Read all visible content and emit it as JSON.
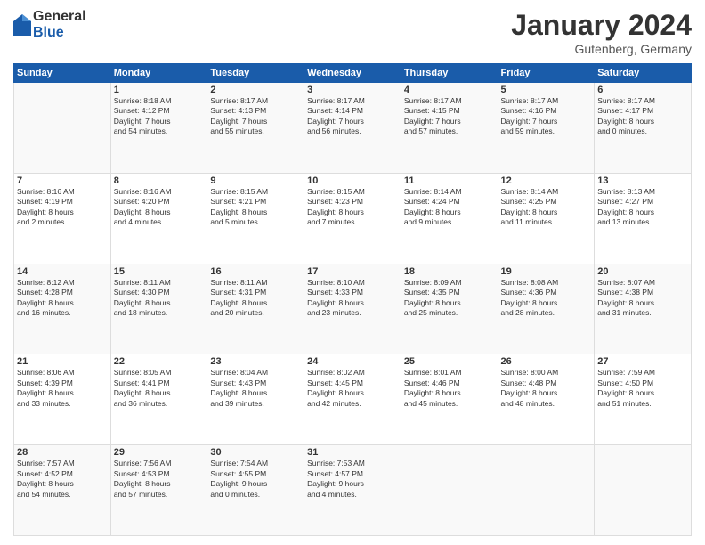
{
  "header": {
    "logo": {
      "general": "General",
      "blue": "Blue"
    },
    "title": "January 2024",
    "location": "Gutenberg, Germany"
  },
  "weekdays": [
    "Sunday",
    "Monday",
    "Tuesday",
    "Wednesday",
    "Thursday",
    "Friday",
    "Saturday"
  ],
  "weeks": [
    [
      {
        "day": "",
        "info": ""
      },
      {
        "day": "1",
        "info": "Sunrise: 8:18 AM\nSunset: 4:12 PM\nDaylight: 7 hours\nand 54 minutes."
      },
      {
        "day": "2",
        "info": "Sunrise: 8:17 AM\nSunset: 4:13 PM\nDaylight: 7 hours\nand 55 minutes."
      },
      {
        "day": "3",
        "info": "Sunrise: 8:17 AM\nSunset: 4:14 PM\nDaylight: 7 hours\nand 56 minutes."
      },
      {
        "day": "4",
        "info": "Sunrise: 8:17 AM\nSunset: 4:15 PM\nDaylight: 7 hours\nand 57 minutes."
      },
      {
        "day": "5",
        "info": "Sunrise: 8:17 AM\nSunset: 4:16 PM\nDaylight: 7 hours\nand 59 minutes."
      },
      {
        "day": "6",
        "info": "Sunrise: 8:17 AM\nSunset: 4:17 PM\nDaylight: 8 hours\nand 0 minutes."
      }
    ],
    [
      {
        "day": "7",
        "info": "Sunrise: 8:16 AM\nSunset: 4:19 PM\nDaylight: 8 hours\nand 2 minutes."
      },
      {
        "day": "8",
        "info": "Sunrise: 8:16 AM\nSunset: 4:20 PM\nDaylight: 8 hours\nand 4 minutes."
      },
      {
        "day": "9",
        "info": "Sunrise: 8:15 AM\nSunset: 4:21 PM\nDaylight: 8 hours\nand 5 minutes."
      },
      {
        "day": "10",
        "info": "Sunrise: 8:15 AM\nSunset: 4:23 PM\nDaylight: 8 hours\nand 7 minutes."
      },
      {
        "day": "11",
        "info": "Sunrise: 8:14 AM\nSunset: 4:24 PM\nDaylight: 8 hours\nand 9 minutes."
      },
      {
        "day": "12",
        "info": "Sunrise: 8:14 AM\nSunset: 4:25 PM\nDaylight: 8 hours\nand 11 minutes."
      },
      {
        "day": "13",
        "info": "Sunrise: 8:13 AM\nSunset: 4:27 PM\nDaylight: 8 hours\nand 13 minutes."
      }
    ],
    [
      {
        "day": "14",
        "info": "Sunrise: 8:12 AM\nSunset: 4:28 PM\nDaylight: 8 hours\nand 16 minutes."
      },
      {
        "day": "15",
        "info": "Sunrise: 8:11 AM\nSunset: 4:30 PM\nDaylight: 8 hours\nand 18 minutes."
      },
      {
        "day": "16",
        "info": "Sunrise: 8:11 AM\nSunset: 4:31 PM\nDaylight: 8 hours\nand 20 minutes."
      },
      {
        "day": "17",
        "info": "Sunrise: 8:10 AM\nSunset: 4:33 PM\nDaylight: 8 hours\nand 23 minutes."
      },
      {
        "day": "18",
        "info": "Sunrise: 8:09 AM\nSunset: 4:35 PM\nDaylight: 8 hours\nand 25 minutes."
      },
      {
        "day": "19",
        "info": "Sunrise: 8:08 AM\nSunset: 4:36 PM\nDaylight: 8 hours\nand 28 minutes."
      },
      {
        "day": "20",
        "info": "Sunrise: 8:07 AM\nSunset: 4:38 PM\nDaylight: 8 hours\nand 31 minutes."
      }
    ],
    [
      {
        "day": "21",
        "info": "Sunrise: 8:06 AM\nSunset: 4:39 PM\nDaylight: 8 hours\nand 33 minutes."
      },
      {
        "day": "22",
        "info": "Sunrise: 8:05 AM\nSunset: 4:41 PM\nDaylight: 8 hours\nand 36 minutes."
      },
      {
        "day": "23",
        "info": "Sunrise: 8:04 AM\nSunset: 4:43 PM\nDaylight: 8 hours\nand 39 minutes."
      },
      {
        "day": "24",
        "info": "Sunrise: 8:02 AM\nSunset: 4:45 PM\nDaylight: 8 hours\nand 42 minutes."
      },
      {
        "day": "25",
        "info": "Sunrise: 8:01 AM\nSunset: 4:46 PM\nDaylight: 8 hours\nand 45 minutes."
      },
      {
        "day": "26",
        "info": "Sunrise: 8:00 AM\nSunset: 4:48 PM\nDaylight: 8 hours\nand 48 minutes."
      },
      {
        "day": "27",
        "info": "Sunrise: 7:59 AM\nSunset: 4:50 PM\nDaylight: 8 hours\nand 51 minutes."
      }
    ],
    [
      {
        "day": "28",
        "info": "Sunrise: 7:57 AM\nSunset: 4:52 PM\nDaylight: 8 hours\nand 54 minutes."
      },
      {
        "day": "29",
        "info": "Sunrise: 7:56 AM\nSunset: 4:53 PM\nDaylight: 8 hours\nand 57 minutes."
      },
      {
        "day": "30",
        "info": "Sunrise: 7:54 AM\nSunset: 4:55 PM\nDaylight: 9 hours\nand 0 minutes."
      },
      {
        "day": "31",
        "info": "Sunrise: 7:53 AM\nSunset: 4:57 PM\nDaylight: 9 hours\nand 4 minutes."
      },
      {
        "day": "",
        "info": ""
      },
      {
        "day": "",
        "info": ""
      },
      {
        "day": "",
        "info": ""
      }
    ]
  ]
}
